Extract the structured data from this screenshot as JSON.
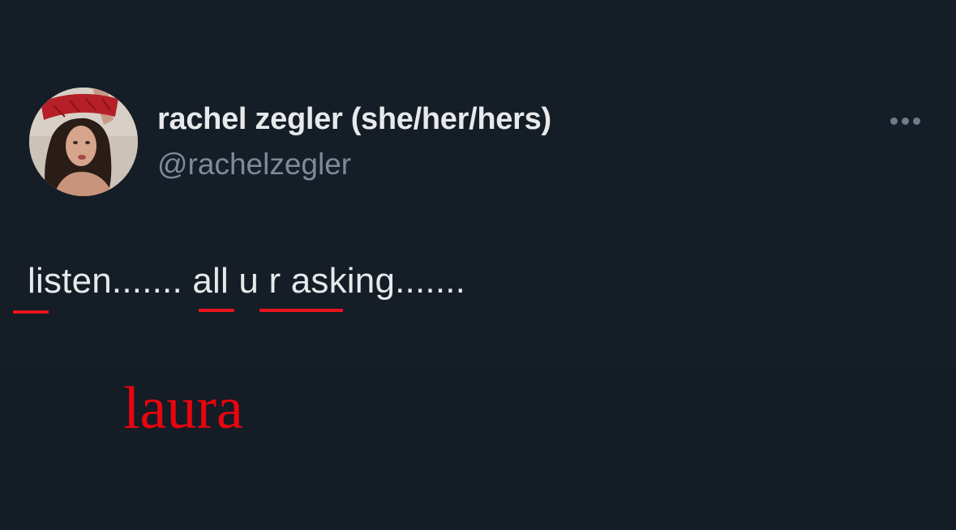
{
  "tweet": {
    "author": {
      "display_name": "rachel zegler (she/her/hers)",
      "handle": "@rachelzegler",
      "avatar_icon": "profile-photo"
    },
    "more_icon": "more-options-icon",
    "text": "listen....... all u r asking.......",
    "colors": {
      "background": "#151d27",
      "name": "#e7e9ea",
      "handle": "#7d8b99",
      "annotation": "#e8050e"
    }
  },
  "annotation": {
    "signature": "laura"
  }
}
